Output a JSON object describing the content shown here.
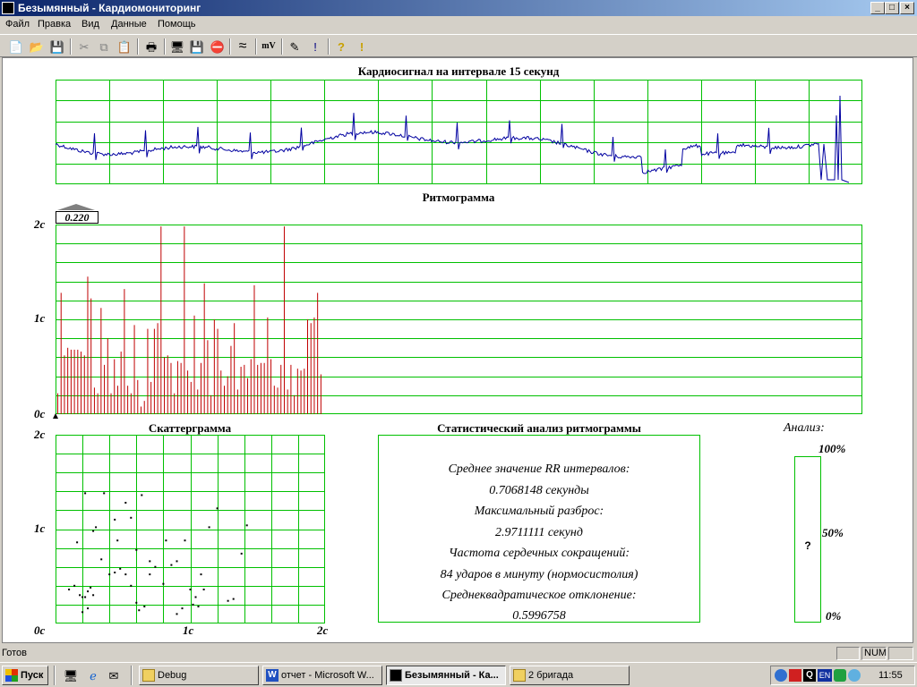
{
  "window": {
    "title": "Безымянный - Кардиомониторинг"
  },
  "menu": [
    "Файл",
    "Правка",
    "Вид",
    "Данные",
    "Помощь"
  ],
  "toolbar": {
    "new": "📄",
    "open": "📂",
    "save": "💾",
    "cut": "✂",
    "copy": "⧉",
    "paste": "📋",
    "print": "🖶",
    "monitor": "🖥",
    "disk": "💾",
    "stop": "⛔",
    "wave": "≈",
    "mv": "mV",
    "edit": "✎",
    "help": "?",
    "info": "!"
  },
  "ecg": {
    "title": "Кардиосигнал на интервале 15 секунд"
  },
  "rhythm": {
    "title": "Ритмограмма",
    "marker": "0.220",
    "y_labels": [
      "2с",
      "1с",
      "0с"
    ],
    "values": [
      0.22,
      1.28,
      0.62,
      0.7,
      0.68,
      0.68,
      0.68,
      0.66,
      0.62,
      1.45,
      1.22,
      0.28,
      0.22,
      1.12,
      0.52,
      0.8,
      0.22,
      0.58,
      0.3,
      0.66,
      1.32,
      0.3,
      0.22,
      0.94,
      0.36,
      0.08,
      0.14,
      0.9,
      0.34,
      0.9,
      0.96,
      1.98,
      0.6,
      0.62,
      0.54,
      0.22,
      0.56,
      0.54,
      1.98,
      0.46,
      0.34,
      1.04,
      0.26,
      0.54,
      1.38,
      0.78,
      0.2,
      1.0,
      0.9,
      0.46,
      0.3,
      0.4,
      0.72,
      0.96,
      0.26,
      0.5,
      0.52,
      0.38,
      0.58,
      1.36,
      0.52,
      0.54,
      0.54,
      1.02,
      0.58,
      0.3,
      0.28,
      0.52,
      1.98,
      0.26,
      0.52,
      0.2,
      0.48,
      0.46,
      0.48,
      1.0,
      0.96,
      1.02,
      1.28,
      0.42
    ]
  },
  "scatter": {
    "title": "Скаттерграмма",
    "y_labels": [
      "2с",
      "1с",
      "0с"
    ],
    "x_labels": [
      "1с",
      "2с"
    ],
    "points": [
      [
        0.22,
        0.28
      ],
      [
        0.24,
        0.34
      ],
      [
        0.26,
        0.38
      ],
      [
        0.28,
        0.3
      ],
      [
        0.18,
        0.3
      ],
      [
        0.2,
        0.28
      ],
      [
        0.22,
        1.38
      ],
      [
        0.1,
        0.36
      ],
      [
        0.14,
        0.4
      ],
      [
        0.16,
        0.86
      ],
      [
        0.28,
        0.98
      ],
      [
        0.4,
        0.52
      ],
      [
        0.44,
        0.54
      ],
      [
        0.48,
        0.58
      ],
      [
        0.52,
        1.28
      ],
      [
        0.56,
        1.12
      ],
      [
        0.6,
        0.78
      ],
      [
        0.64,
        1.36
      ],
      [
        0.7,
        0.66
      ],
      [
        0.8,
        0.42
      ],
      [
        0.9,
        0.1
      ],
      [
        0.96,
        0.88
      ],
      [
        1.0,
        0.36
      ],
      [
        1.02,
        0.2
      ],
      [
        1.08,
        0.52
      ],
      [
        1.14,
        1.02
      ],
      [
        1.2,
        1.22
      ],
      [
        1.28,
        0.24
      ],
      [
        1.32,
        0.26
      ],
      [
        1.38,
        0.74
      ],
      [
        1.42,
        1.04
      ],
      [
        0.36,
        1.38
      ],
      [
        0.34,
        0.68
      ],
      [
        0.46,
        0.88
      ],
      [
        0.7,
        0.52
      ],
      [
        0.74,
        0.6
      ],
      [
        0.82,
        0.88
      ],
      [
        0.86,
        0.62
      ],
      [
        0.9,
        0.66
      ],
      [
        0.94,
        0.16
      ],
      [
        1.04,
        0.28
      ],
      [
        1.1,
        0.36
      ],
      [
        1.06,
        0.18
      ],
      [
        0.52,
        0.52
      ],
      [
        0.56,
        0.4
      ],
      [
        0.6,
        0.22
      ],
      [
        0.62,
        0.14
      ],
      [
        0.66,
        0.18
      ],
      [
        0.44,
        1.1
      ],
      [
        0.3,
        1.02
      ],
      [
        0.2,
        0.12
      ],
      [
        0.24,
        0.16
      ]
    ]
  },
  "stats": {
    "title": "Статистический анализ ритмограммы",
    "lines": [
      "Среднее значение RR интервалов:",
      "0.7068148 секунды",
      "Максимальный разброс:",
      "2.9711111 секунд",
      "Частота сердечных сокращений:",
      "84 ударов в минуту (нормосистолия)",
      "Среднеквадратическое отклонение:",
      "0.5996758"
    ]
  },
  "analysis": {
    "title": "Анализ:",
    "p100": "100%",
    "p50": "50%",
    "p0": "0%",
    "mark": "?"
  },
  "status": {
    "text": "Готов",
    "num": "NUM"
  },
  "taskbar": {
    "start": "Пуск",
    "buttons": [
      "Debug",
      "отчет - Microsoft W...",
      "Безымянный - Ка...",
      "2 бригада"
    ],
    "lang": "EN",
    "clock": "11:55"
  },
  "colors": {
    "grid": "#00c000",
    "ecg": "#0000a0",
    "rhythm": "#c00000"
  }
}
